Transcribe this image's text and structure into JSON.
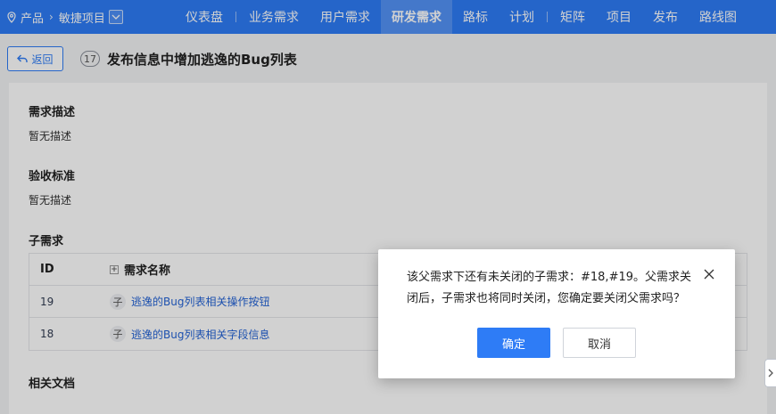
{
  "topbar": {
    "breadcrumb": {
      "root": "产品",
      "separator": "›",
      "current": "敏捷项目"
    },
    "nav": [
      {
        "label": "仪表盘",
        "active": false
      },
      {
        "label": "业务需求",
        "active": false
      },
      {
        "label": "用户需求",
        "active": false
      },
      {
        "label": "研发需求",
        "active": true
      },
      {
        "label": "路标",
        "active": false
      },
      {
        "label": "计划",
        "active": false
      },
      {
        "label": "矩阵",
        "active": false
      },
      {
        "label": "项目",
        "active": false
      },
      {
        "label": "发布",
        "active": false
      },
      {
        "label": "路线图",
        "active": false
      }
    ],
    "color": "#2e7cf6"
  },
  "header": {
    "back_label": "返回",
    "story_id": "17",
    "title": "发布信息中增加逃逸的Bug列表"
  },
  "sections": {
    "description_title": "需求描述",
    "description_text": "暂无描述",
    "acceptance_title": "验收标准",
    "acceptance_text": "暂无描述",
    "children_title": "子需求",
    "docs_title": "相关文档"
  },
  "table": {
    "headers": {
      "id": "ID",
      "name": "需求名称"
    },
    "rows": [
      {
        "id": "19",
        "tag": "子",
        "name": "逃逸的Bug列表相关操作按钮"
      },
      {
        "id": "18",
        "tag": "子",
        "name": "逃逸的Bug列表相关字段信息"
      }
    ]
  },
  "modal": {
    "message": "该父需求下还有未关闭的子需求：#18,#19。父需求关闭后，子需求也将同时关闭，您确定要关闭父需求吗？",
    "ok_label": "确定",
    "cancel_label": "取消"
  }
}
